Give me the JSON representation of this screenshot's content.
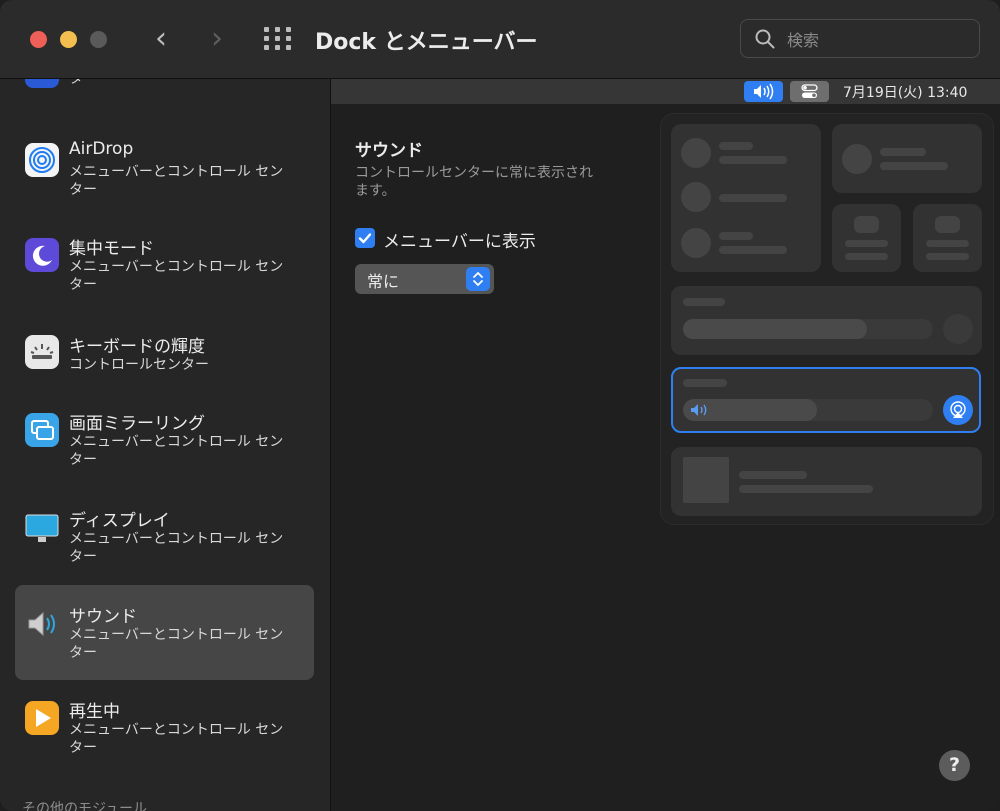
{
  "window": {
    "title": "Dock とメニューバー"
  },
  "search": {
    "placeholder": "検索"
  },
  "sidebar": {
    "top_partial": {
      "sub": "メニューバーとコントロール センター"
    },
    "items": [
      {
        "title": "AirDrop",
        "sub": "メニューバーとコントロール センター",
        "icon": "airdrop-icon"
      },
      {
        "title": "集中モード",
        "sub": "メニューバーとコントロール センター",
        "icon": "focus-moon-icon"
      },
      {
        "title": "キーボードの輝度",
        "sub": "コントロールセンター",
        "icon": "keyboard-brightness-icon"
      },
      {
        "title": "画面ミラーリング",
        "sub": "メニューバーとコントロール センター",
        "icon": "screen-mirroring-icon"
      },
      {
        "title": "ディスプレイ",
        "sub": "メニューバーとコントロール センター",
        "icon": "display-icon"
      },
      {
        "title": "サウンド",
        "sub": "メニューバーとコントロール センター",
        "icon": "speaker-icon"
      },
      {
        "title": "再生中",
        "sub": "メニューバーとコントロール センター",
        "icon": "now-playing-icon"
      }
    ],
    "footer": "その他のモジュール"
  },
  "menubar_preview": {
    "date_time": "7月19日(火)  13:40"
  },
  "section": {
    "title": "サウンド",
    "description": "コントロールセンターに常に表示されます。",
    "checkbox_label": "メニューバーに表示",
    "checkbox_checked": true,
    "select_value": "常に"
  },
  "help": {
    "label": "?"
  },
  "colors": {
    "accent": "#2f7ff2",
    "background": "#1e1e1e"
  }
}
